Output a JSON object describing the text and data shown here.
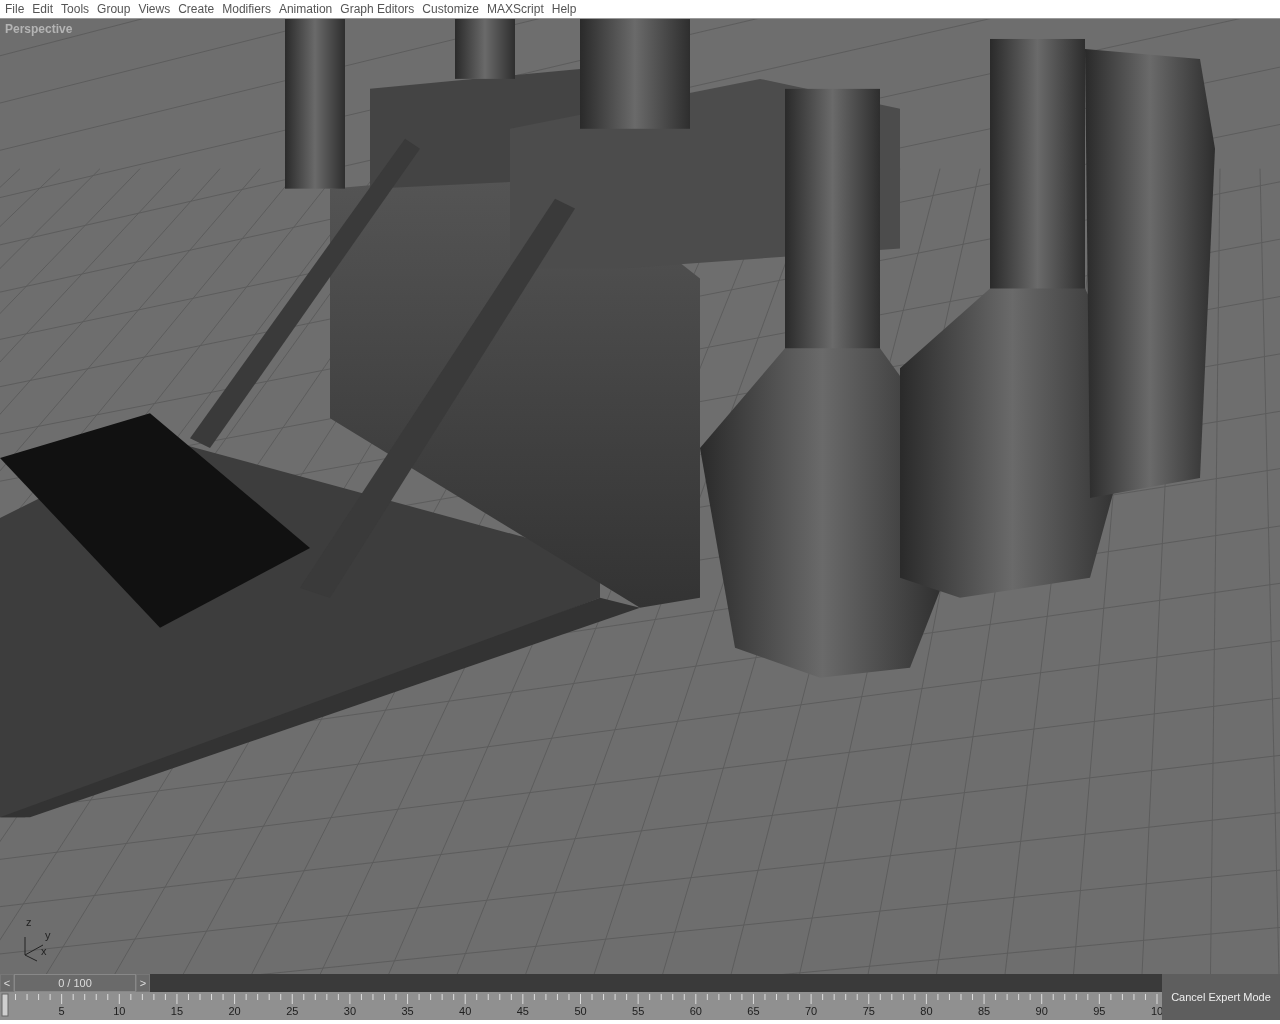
{
  "menu_bar": {
    "items": [
      "File",
      "Edit",
      "Tools",
      "Group",
      "Views",
      "Create",
      "Modifiers",
      "Animation",
      "Graph Editors",
      "Customize",
      "MAXScript",
      "Help"
    ]
  },
  "viewport": {
    "label": "Perspective",
    "axis_labels": [
      "z",
      "y",
      "x"
    ]
  },
  "time_slider": {
    "prev": "<",
    "position": "0 / 100",
    "next": ">",
    "level": 0
  },
  "track_bar": {
    "labels": [
      "5",
      "10",
      "15",
      "20",
      "25",
      "30",
      "35",
      "40",
      "45",
      "50",
      "55",
      "60",
      "65",
      "70",
      "75",
      "80",
      "85",
      "90",
      "95",
      "10"
    ]
  },
  "cancel_button": {
    "label": "Cancel Expert Mode"
  }
}
